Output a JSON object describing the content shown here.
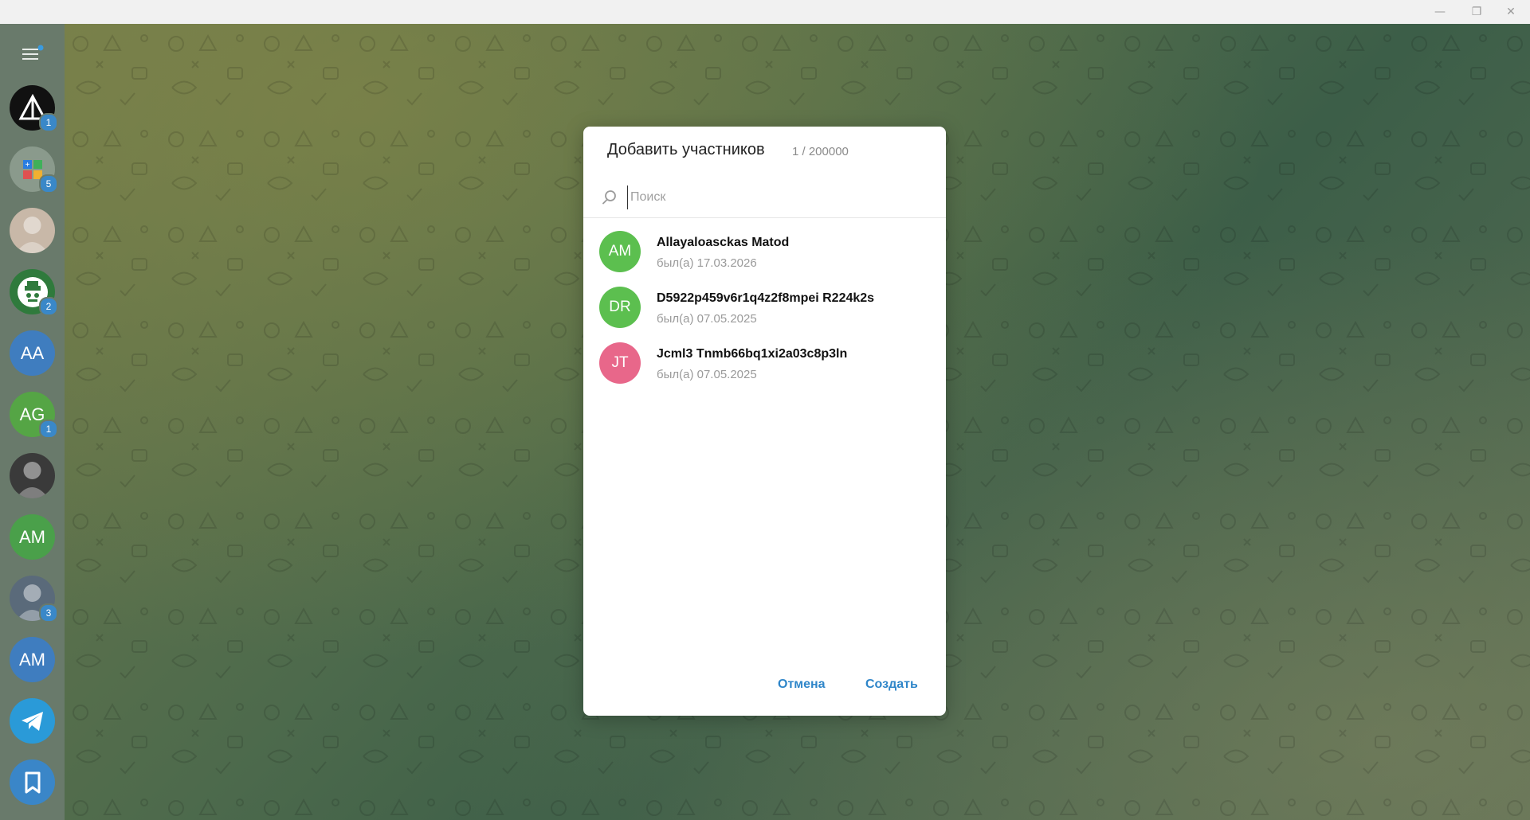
{
  "window": {
    "controls": {
      "minimize": "—",
      "restore": "❐",
      "close": "✕"
    }
  },
  "sidebar": {
    "menu_icon": "hamburger-menu-icon",
    "items": [
      {
        "type": "logo",
        "icon": "triangle-logo-icon",
        "badge": "1",
        "bg": "#111111"
      },
      {
        "type": "logo",
        "icon": "apps-grid-icon",
        "badge": "5",
        "bg": "#8a9a8c"
      },
      {
        "type": "photo",
        "icon": "portrait-photo",
        "badge": "",
        "bg": "#c8b8a8"
      },
      {
        "type": "logo",
        "icon": "bot-hat-icon",
        "badge": "2",
        "bg": "#2f7a3c"
      },
      {
        "type": "initials",
        "text": "AA",
        "badge": "",
        "bg": "#3f7dbf"
      },
      {
        "type": "initials",
        "text": "AG",
        "badge": "1",
        "bg": "#55a545"
      },
      {
        "type": "photo",
        "icon": "portrait-photo",
        "badge": "",
        "bg": "#3a3a3a"
      },
      {
        "type": "initials",
        "text": "AM",
        "badge": "",
        "bg": "#4aa04a"
      },
      {
        "type": "photo",
        "icon": "portrait-photo",
        "badge": "3",
        "bg": "#5a6a7a"
      },
      {
        "type": "initials",
        "text": "AM",
        "badge": "",
        "bg": "#3f7dbf"
      },
      {
        "type": "logo",
        "icon": "telegram-plane-icon",
        "badge": "",
        "bg": "#2a9ad8"
      },
      {
        "type": "logo",
        "icon": "bookmark-icon",
        "badge": "",
        "bg": "#3a86c8"
      }
    ]
  },
  "dialog": {
    "title": "Добавить участников",
    "count": "1 / 200000",
    "search": {
      "placeholder": "Поиск",
      "value": ""
    },
    "contacts": [
      {
        "initials": "AM",
        "name": "Allayaloasckas Matod",
        "status": "был(а) 17.03.2026",
        "color": "#5cbf4f"
      },
      {
        "initials": "DR",
        "name": "D5922p459v6r1q4z2f8mpei R224k2s",
        "status": "был(а) 07.05.2025",
        "color": "#5cbf4f"
      },
      {
        "initials": "JT",
        "name": "Jcml3 Tnmb66bq1xi2a03c8p3ln",
        "status": "был(а) 07.05.2025",
        "color": "#e8678a"
      }
    ],
    "cancel_label": "Отмена",
    "create_label": "Создать"
  }
}
